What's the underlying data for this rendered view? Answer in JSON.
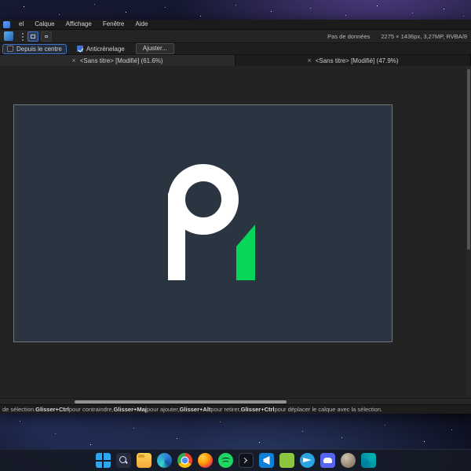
{
  "colors": {
    "logo_green": "#06d75a",
    "logo_white": "#ffffff",
    "canvas_bg": "#2b3541",
    "accent_blue": "#3f72c8"
  },
  "menubar": {
    "items": [
      "el",
      "Calque",
      "Affichage",
      "Fenêtre",
      "Aide"
    ]
  },
  "toolbar": {
    "no_data_label": "Pas de données",
    "doc_info": "2275 × 1436px, 3,27MP, RVBA/8"
  },
  "options": {
    "from_center": "Depuis le centre",
    "antialias": "Anticrénelage",
    "adjust": "Ajuster..."
  },
  "tabs": [
    {
      "close": "×",
      "label": "<Sans titre> [Modifié] (61.6%)"
    },
    {
      "close": "×",
      "label": "<Sans titre> [Modifié] (47.9%)"
    }
  ],
  "statusbar": {
    "segments": [
      "de sélection. ",
      "Glisser+Ctrl",
      " pour contraindre, ",
      "Glisser+Maj",
      " pour ajouter, ",
      "Glisser+Alt",
      " pour retirer, ",
      "Glisser+Ctrl",
      " pour déplacer le calque avec la sélection."
    ]
  },
  "taskbar": {
    "icons": [
      "start",
      "search",
      "explorer",
      "edge",
      "chrome",
      "firefox",
      "spotify",
      "terminal",
      "vscode",
      "notepad",
      "telegram",
      "discord",
      "gimp",
      "krita"
    ]
  }
}
